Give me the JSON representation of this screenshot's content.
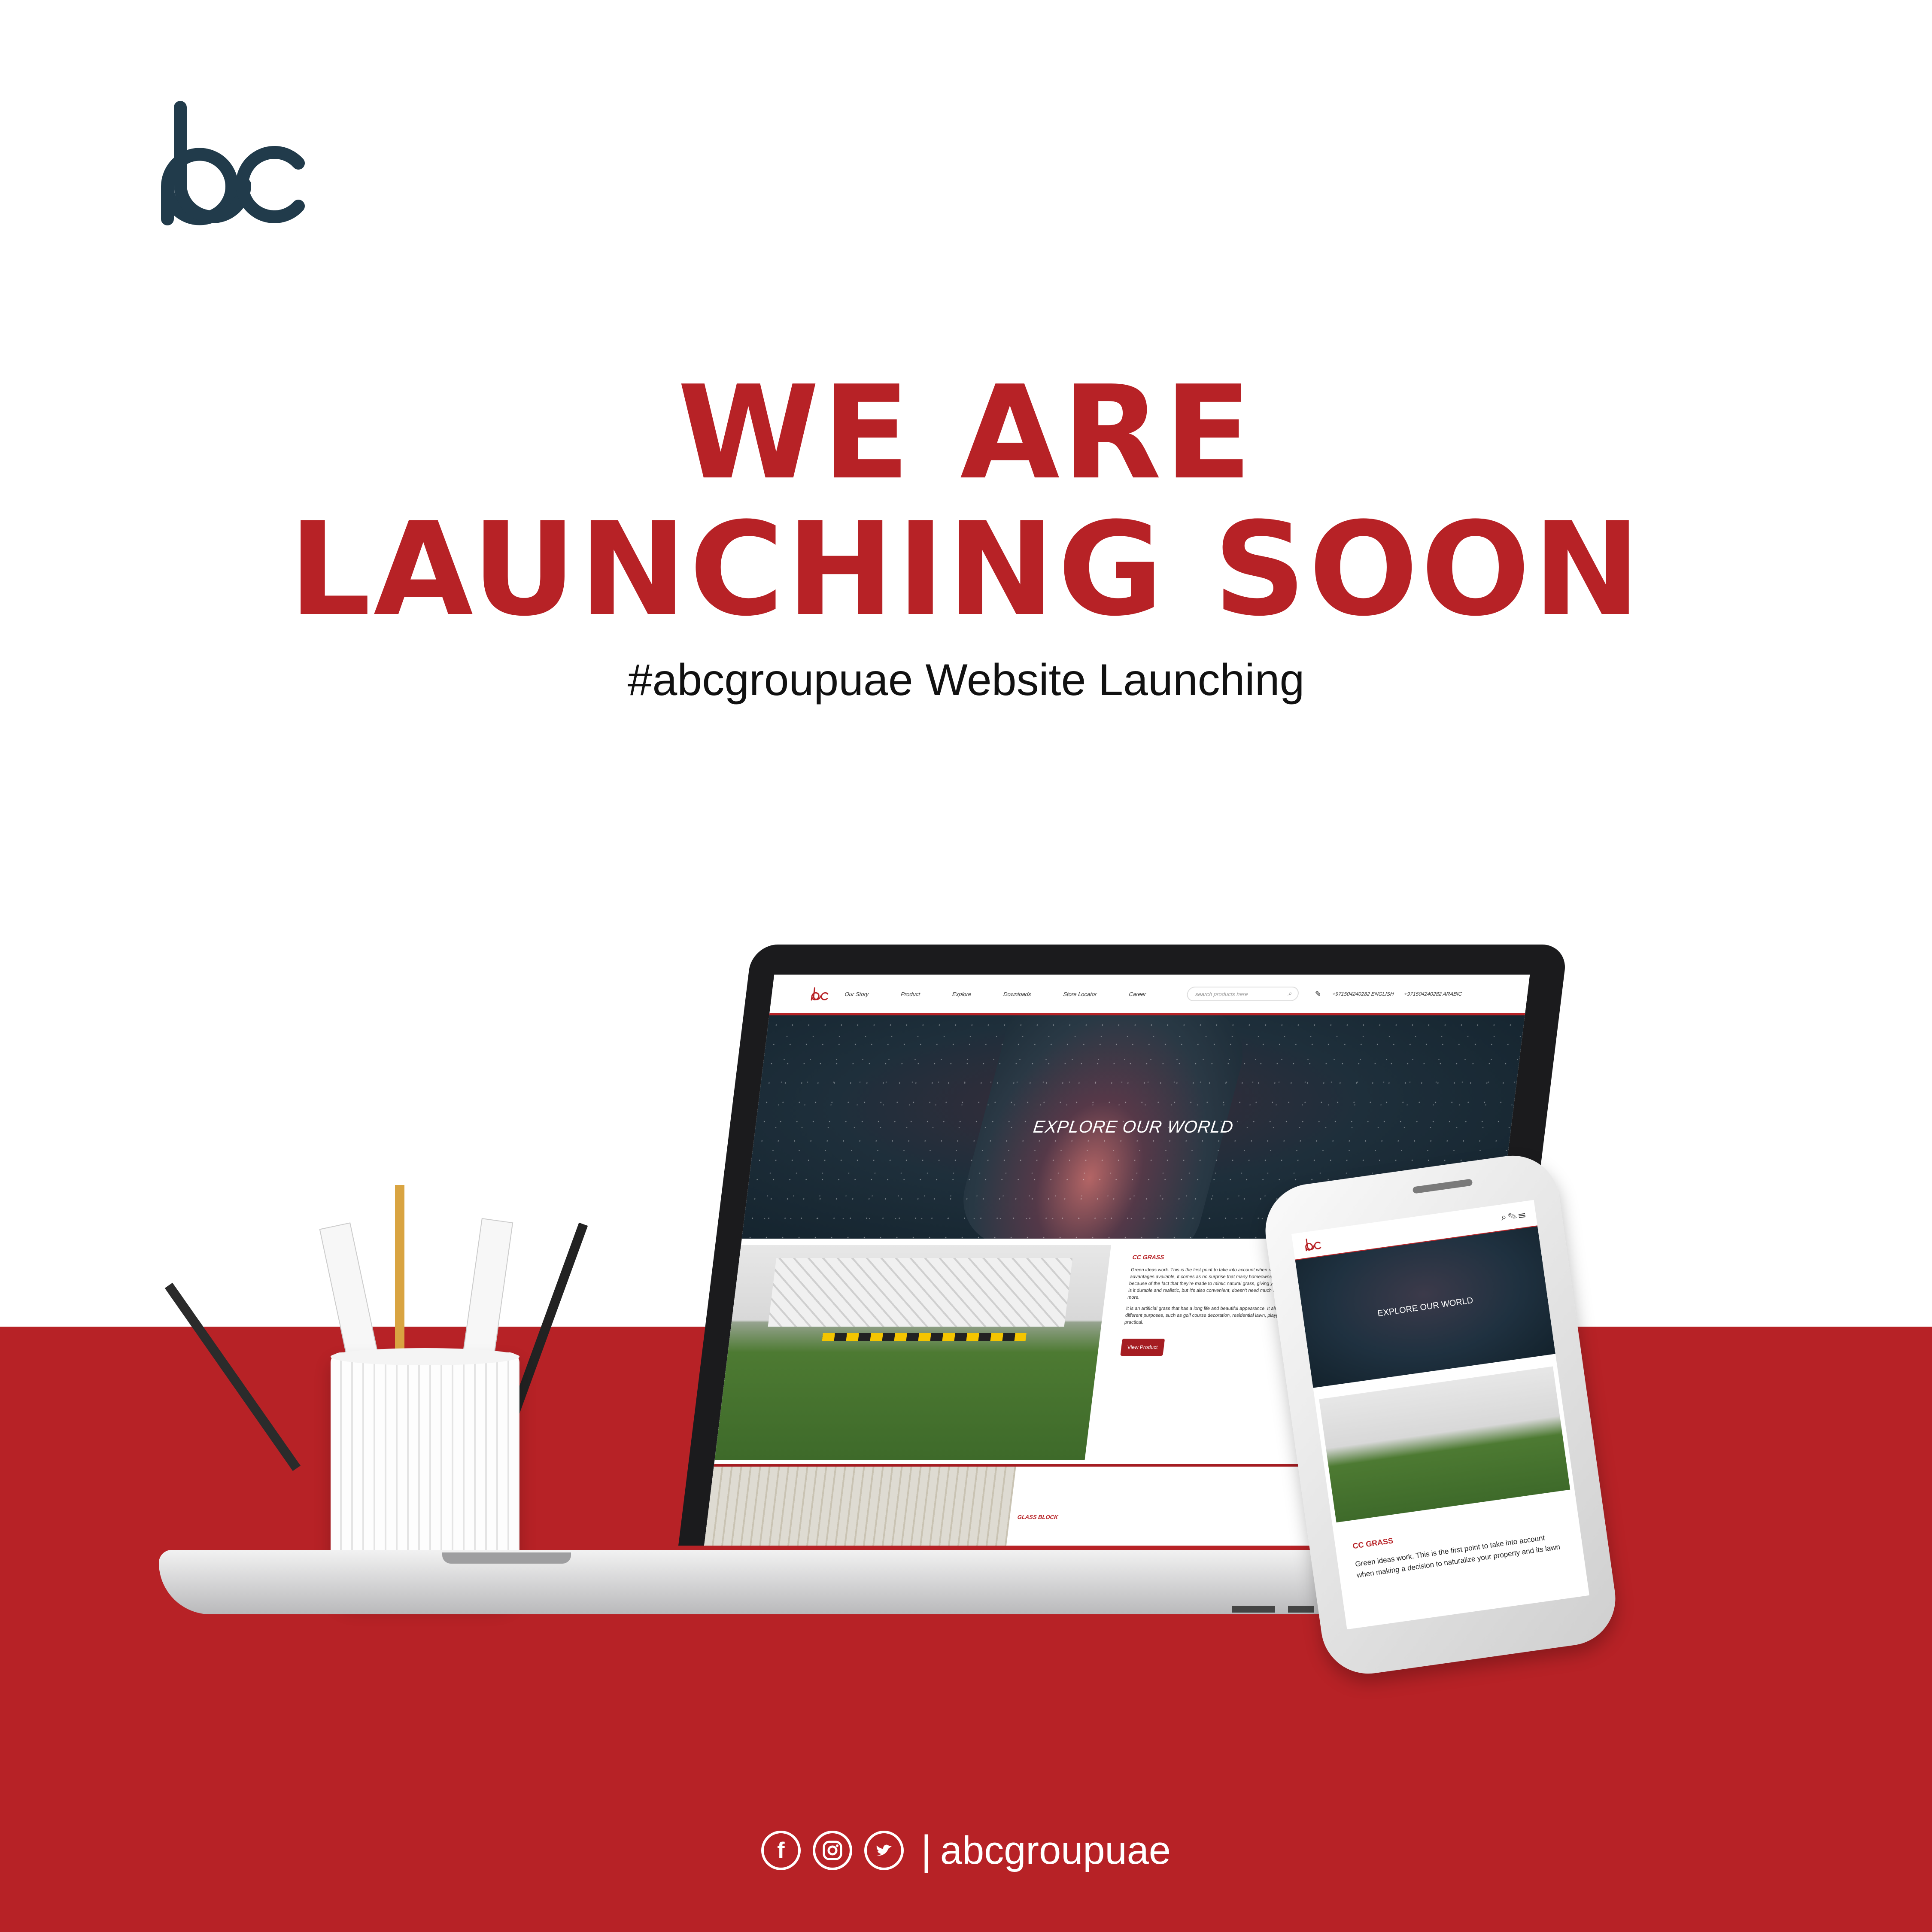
{
  "brand": {
    "logo_text": "abc",
    "logo_color": "#213b4b",
    "accent": "#b72226"
  },
  "headline": {
    "line1": "WE ARE",
    "line2": "LAUNCHING SOON"
  },
  "subtitle": "#abcgroupuae Website Launching",
  "footer": {
    "handle": "abcgroupuae",
    "separator": "|",
    "icons": [
      "facebook-icon",
      "instagram-icon",
      "twitter-icon"
    ]
  },
  "laptop_site": {
    "nav": [
      "Our Story",
      "Product",
      "Explore",
      "Downloads",
      "Store Locator",
      "Career"
    ],
    "search_placeholder": "search products here",
    "phone_english": "+971504240282 ENGLISH",
    "phone_arabic": "+971504240282 ARABIC",
    "hero_text": "EXPLORE OUR WORLD",
    "product_title": "CC GRASS",
    "product_p1": "Green ideas work. This is the first point to take into account when making a decision to naturalize your property and its lawn with grass. With the wide range of advantages available, it comes as no surprise that many homeowners are replacing lawns with artificial turf. The most installing artificial grasses have to be so good because of the fact that they're made to mimic natural grass, giving you all the benefits and none of the problems everyone has experienced with real grass. Not only is it durable and realistic, but it's also convenient, doesn't need much maintenance, environmentally friendly, strong enough be withstand even high traffic areas and more.",
    "product_p2": "It is an artificial grass that has a long life and beautiful appearance. It also has good drainage, so it's available to be used in the front yard.It is widely applied for different purposes, such as golf course decoration, residential lawn, playground grass ground cover and backyard landscape decoration. Thus the CC grass is really practical.",
    "product_button": "View Product",
    "product2_title": "GLASS BLOCK"
  },
  "phone_site": {
    "hero_text": "EXPLORE OUR WORLD",
    "product_title": "CC GRASS",
    "product_text": "Green ideas work. This is the first point to take into account when making a decision to naturalize your property and its lawn"
  }
}
